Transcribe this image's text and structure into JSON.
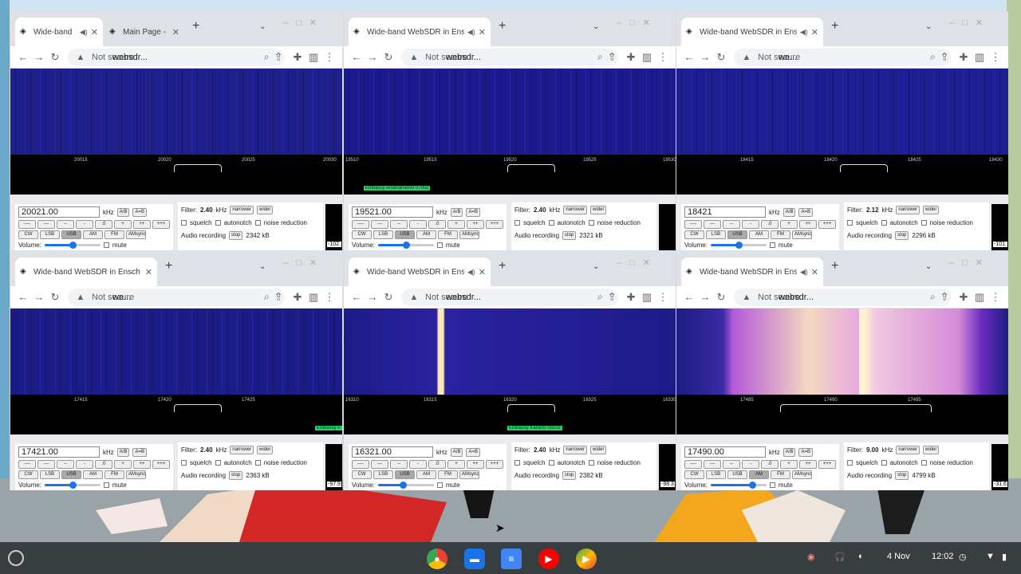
{
  "windows": [
    {
      "tabs": [
        {
          "title": "Wide-band",
          "active": true,
          "favicon": "web-icon",
          "audio": true
        },
        {
          "title": "Main Page -",
          "active": false,
          "favicon": "web-icon",
          "audio": false
        }
      ],
      "address": {
        "security": "Not secure",
        "url": "websdr..."
      },
      "waterfall_color": "#1f1f8c",
      "ticks": [
        "20015",
        "20020",
        "20025",
        "20030"
      ],
      "stations": [],
      "frequency": "20021.00",
      "filter": "2.40",
      "selected_mode": "USB",
      "recorded": "2342 kB",
      "smeter": "-102.",
      "volume": 0.5
    },
    {
      "tabs": [
        {
          "title": "Wide-band WebSDR in Ensch",
          "active": true,
          "favicon": "web-icon",
          "audio": true
        }
      ],
      "address": {
        "security": "Not secure",
        "url": "websdr..."
      },
      "waterfall_color": "#1c1a8c",
      "ticks": [
        "19510",
        "19515",
        "19520",
        "19525",
        "19530"
      ],
      "stations": [
        "Embassy Antananarivo 0700z"
      ],
      "frequency": "19521.00",
      "filter": "2.40",
      "selected_mode": "USB",
      "recorded": "2321 kB",
      "smeter": "",
      "volume": 0.5
    },
    {
      "tabs": [
        {
          "title": "Wide-band WebSDR in Ensch",
          "active": true,
          "favicon": "web-icon",
          "audio": true
        }
      ],
      "address": {
        "security": "Not secure",
        "url": "we..."
      },
      "waterfall_color": "#1d1e92",
      "ticks": [
        "18415",
        "18420",
        "18425",
        "18430"
      ],
      "stations": [],
      "frequency": "18421",
      "filter": "2.12",
      "selected_mode": "USB",
      "recorded": "2296 kB",
      "smeter": "-101.",
      "volume": 0.5
    },
    {
      "tabs": [
        {
          "title": "Wide-band WebSDR in Ensch",
          "active": true,
          "favicon": "web-icon",
          "audio": false
        }
      ],
      "address": {
        "security": "Not secure",
        "url": "we..."
      },
      "waterfall_color": "#1c1c86",
      "ticks": [
        "17415",
        "17420",
        "17425"
      ],
      "stations": [
        "Embassy A"
      ],
      "frequency": "17421.00",
      "filter": "2.40",
      "selected_mode": "USB",
      "recorded": "2363 kB",
      "smeter": "-97.9",
      "volume": 0.5
    },
    {
      "tabs": [
        {
          "title": "Wide-band WebSDR in Ensch",
          "active": true,
          "favicon": "web-icon",
          "audio": true
        }
      ],
      "address": {
        "security": "Not secure",
        "url": "websdr..."
      },
      "waterfall_color": "#1e1a88",
      "ticks": [
        "16310",
        "16315",
        "16320",
        "16325",
        "16330"
      ],
      "stations": [
        "Embassy Karachi 0810z"
      ],
      "frequency": "16321.00",
      "filter": "2.40",
      "selected_mode": "USB",
      "recorded": "2382 kB",
      "smeter": "-98.3",
      "volume": 0.45
    },
    {
      "tabs": [
        {
          "title": "Wide-band WebSDR in Ensch",
          "active": true,
          "favicon": "web-icon",
          "audio": true
        }
      ],
      "address": {
        "security": "Not secure",
        "url": "websdr..."
      },
      "waterfall_color": "#7a2bd0",
      "ticks": [
        "17485",
        "17490",
        "17495"
      ],
      "stations": [],
      "frequency": "17490.00",
      "filter": "9.00",
      "selected_mode": "AM",
      "recorded": "4799 kB",
      "smeter": "-31.6",
      "volume": 0.75
    }
  ],
  "common": {
    "freq_unit": "kHz",
    "ab": "A/B",
    "aeqb": "A=B",
    "steps": [
      "----",
      "---",
      "--",
      "-",
      ".0",
      "+",
      "++",
      "+++"
    ],
    "modes": [
      "CW",
      "LSB",
      "USB",
      "AM",
      "FM",
      "AMsync"
    ],
    "volume_label": "Volume:",
    "mute_label": "mute",
    "filter_label": "Filter:",
    "filter_unit": "kHz",
    "narrower": "narrower",
    "wider": "wider",
    "squelch": "squelch",
    "autonotch": "autonotch",
    "noise_reduction": "noise reduction",
    "audio_recording": "Audio recording",
    "stop": "stop"
  },
  "shelf": {
    "apps": [
      "chrome-icon",
      "files-icon",
      "docs-icon",
      "youtube-icon",
      "play-store-icon"
    ],
    "date": "4 Nov",
    "time": "12:02"
  }
}
